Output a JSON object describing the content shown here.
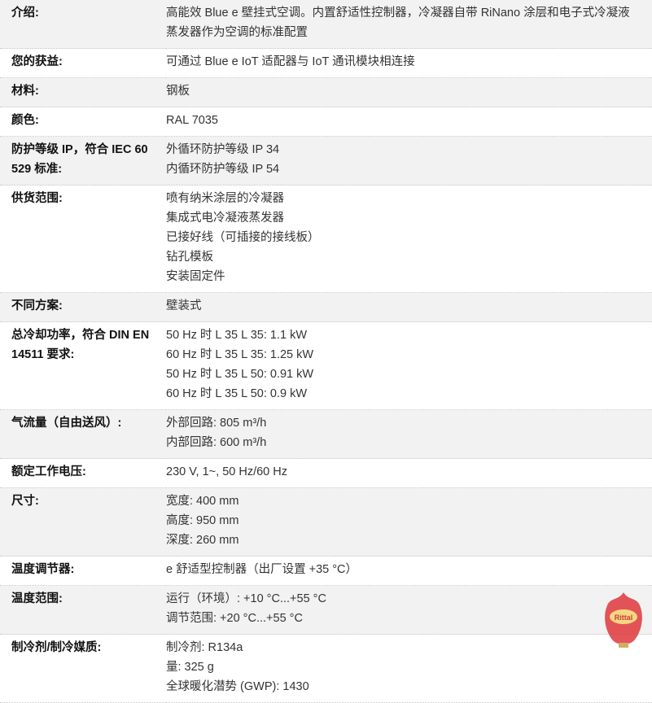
{
  "rows": [
    {
      "key": "介绍:",
      "vals": [
        "高能效 Blue e 壁挂式空调。内置舒适性控制器，冷凝器自带 RiNano 涂层和电子式冷凝液蒸发器作为空调的标准配置"
      ]
    },
    {
      "key": "您的获益:",
      "vals": [
        "可通过 Blue e IoT 适配器与 IoT 通讯模块相连接"
      ]
    },
    {
      "key": "材料:",
      "vals": [
        "钢板"
      ]
    },
    {
      "key": "颜色:",
      "vals": [
        "RAL 7035"
      ]
    },
    {
      "key": "防护等级 IP，符合 IEC 60 529 标准:",
      "vals": [
        "外循环防护等级 IP 34",
        "内循环防护等级 IP 54"
      ]
    },
    {
      "key": "供货范围:",
      "vals": [
        "喷有纳米涂层的冷凝器",
        "集成式电冷凝液蒸发器",
        "已接好线（可插接的接线板）",
        "钻孔模板",
        "安装固定件"
      ]
    },
    {
      "key": "不同方案:",
      "vals": [
        "壁装式"
      ]
    },
    {
      "key": "总冷却功率，符合 DIN EN 14511 要求:",
      "vals": [
        "50 Hz 时 L 35 L 35: 1.1 kW",
        "60 Hz 时 L 35 L 35: 1.25 kW",
        "50 Hz 时 L 35 L 50: 0.91 kW",
        "60 Hz 时 L 35 L 50: 0.9 kW"
      ]
    },
    {
      "key": "气流量（自由送风）:",
      "vals": [
        "外部回路: 805 m³/h",
        "内部回路: 600 m³/h"
      ]
    },
    {
      "key": "额定工作电压:",
      "vals": [
        "230 V, 1~, 50 Hz/60 Hz"
      ]
    },
    {
      "key": "尺寸:",
      "vals": [
        "宽度: 400 mm",
        "高度: 950 mm",
        "深度: 260 mm"
      ]
    },
    {
      "key": "温度调节器:",
      "vals": [
        "e 舒适型控制器（出厂设置 +35 °C）"
      ]
    },
    {
      "key": "温度范围:",
      "vals": [
        "运行（环境）: +10 °C...+55 °C",
        "调节范围: +20 °C...+55 °C"
      ]
    },
    {
      "key": "制冷剂/制冷媒质:",
      "vals": [
        "制冷剂: R134a",
        "量: 325 g",
        "全球暖化潜势 (GWP): 1430"
      ]
    }
  ],
  "watermark": {
    "text": "Rittal",
    "color": "#d8292f"
  }
}
